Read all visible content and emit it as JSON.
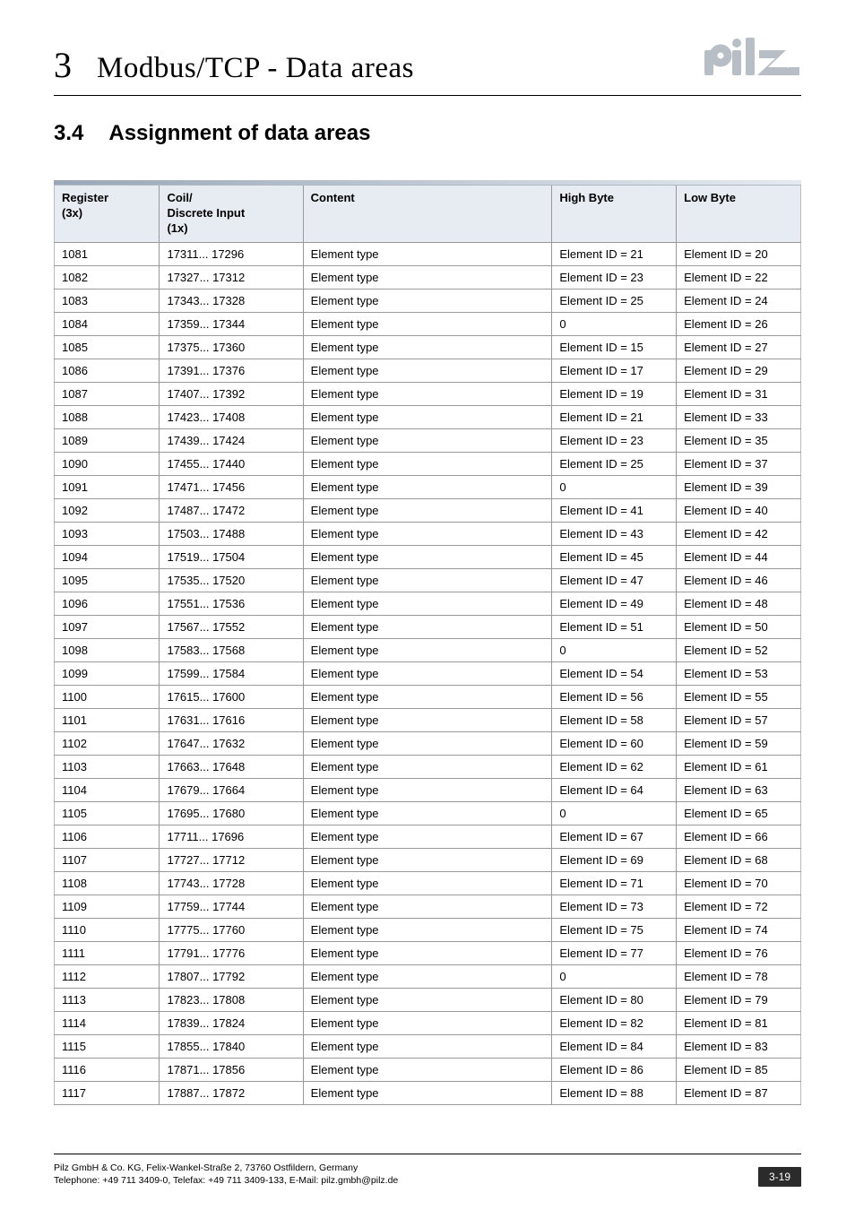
{
  "header": {
    "chapter_number": "3",
    "chapter_title": "Modbus/TCP - Data areas",
    "logo_text": "pilz"
  },
  "section": {
    "number": "3.4",
    "title": "Assignment of data areas"
  },
  "table": {
    "headers": {
      "register": "Register (3x)",
      "coil": "Coil/\nDiscrete Input (1x)",
      "content": "Content",
      "high": "High Byte",
      "low": "Low Byte"
    },
    "rows": [
      {
        "reg": "1081",
        "coil": "17311... 17296",
        "content": "Element type",
        "high": "Element ID = 21",
        "low": "Element ID = 20"
      },
      {
        "reg": "1082",
        "coil": "17327... 17312",
        "content": "Element type",
        "high": "Element ID = 23",
        "low": "Element ID = 22"
      },
      {
        "reg": "1083",
        "coil": "17343... 17328",
        "content": "Element type",
        "high": "Element ID = 25",
        "low": "Element ID = 24"
      },
      {
        "reg": "1084",
        "coil": "17359... 17344",
        "content": "Element type",
        "high": "0",
        "low": "Element ID = 26"
      },
      {
        "reg": "1085",
        "coil": "17375... 17360",
        "content": "Element type",
        "high": "Element ID = 15",
        "low": "Element ID = 27"
      },
      {
        "reg": "1086",
        "coil": "17391... 17376",
        "content": "Element type",
        "high": "Element ID = 17",
        "low": "Element ID = 29"
      },
      {
        "reg": "1087",
        "coil": "17407... 17392",
        "content": "Element type",
        "high": "Element ID = 19",
        "low": "Element ID = 31"
      },
      {
        "reg": "1088",
        "coil": "17423... 17408",
        "content": "Element type",
        "high": "Element ID = 21",
        "low": "Element ID = 33"
      },
      {
        "reg": "1089",
        "coil": "17439... 17424",
        "content": "Element type",
        "high": "Element ID = 23",
        "low": "Element ID = 35"
      },
      {
        "reg": "1090",
        "coil": "17455... 17440",
        "content": "Element type",
        "high": "Element ID = 25",
        "low": "Element ID = 37"
      },
      {
        "reg": "1091",
        "coil": "17471... 17456",
        "content": "Element type",
        "high": "0",
        "low": "Element ID = 39"
      },
      {
        "reg": "1092",
        "coil": "17487... 17472",
        "content": "Element type",
        "high": "Element ID = 41",
        "low": "Element ID = 40"
      },
      {
        "reg": "1093",
        "coil": "17503... 17488",
        "content": "Element type",
        "high": "Element ID = 43",
        "low": "Element ID = 42"
      },
      {
        "reg": "1094",
        "coil": "17519... 17504",
        "content": "Element type",
        "high": "Element ID = 45",
        "low": "Element ID = 44"
      },
      {
        "reg": "1095",
        "coil": "17535... 17520",
        "content": "Element type",
        "high": "Element ID = 47",
        "low": "Element ID = 46"
      },
      {
        "reg": "1096",
        "coil": "17551... 17536",
        "content": "Element type",
        "high": "Element ID = 49",
        "low": "Element ID = 48"
      },
      {
        "reg": "1097",
        "coil": "17567... 17552",
        "content": "Element type",
        "high": "Element ID = 51",
        "low": "Element ID = 50"
      },
      {
        "reg": "1098",
        "coil": "17583... 17568",
        "content": "Element type",
        "high": "0",
        "low": "Element ID = 52"
      },
      {
        "reg": "1099",
        "coil": "17599... 17584",
        "content": "Element type",
        "high": "Element ID = 54",
        "low": "Element ID = 53"
      },
      {
        "reg": "1100",
        "coil": "17615... 17600",
        "content": "Element type",
        "high": "Element ID = 56",
        "low": "Element ID = 55"
      },
      {
        "reg": "1101",
        "coil": "17631... 17616",
        "content": "Element type",
        "high": "Element ID = 58",
        "low": "Element ID = 57"
      },
      {
        "reg": "1102",
        "coil": "17647... 17632",
        "content": "Element type",
        "high": "Element ID = 60",
        "low": "Element ID = 59"
      },
      {
        "reg": "1103",
        "coil": "17663... 17648",
        "content": "Element type",
        "high": "Element ID = 62",
        "low": "Element ID = 61"
      },
      {
        "reg": "1104",
        "coil": "17679... 17664",
        "content": "Element type",
        "high": "Element ID = 64",
        "low": "Element ID = 63"
      },
      {
        "reg": "1105",
        "coil": "17695... 17680",
        "content": "Element type",
        "high": "0",
        "low": "Element ID = 65"
      },
      {
        "reg": "1106",
        "coil": "17711... 17696",
        "content": "Element type",
        "high": "Element ID = 67",
        "low": "Element ID = 66"
      },
      {
        "reg": "1107",
        "coil": "17727... 17712",
        "content": "Element type",
        "high": "Element ID = 69",
        "low": "Element ID = 68"
      },
      {
        "reg": "1108",
        "coil": "17743... 17728",
        "content": "Element type",
        "high": "Element ID = 71",
        "low": "Element ID = 70"
      },
      {
        "reg": "1109",
        "coil": "17759... 17744",
        "content": "Element type",
        "high": "Element ID = 73",
        "low": "Element ID = 72"
      },
      {
        "reg": "1110",
        "coil": "17775... 17760",
        "content": "Element type",
        "high": "Element ID = 75",
        "low": "Element ID = 74"
      },
      {
        "reg": "1111",
        "coil": "17791... 17776",
        "content": "Element type",
        "high": "Element ID = 77",
        "low": "Element ID = 76"
      },
      {
        "reg": "1112",
        "coil": "17807... 17792",
        "content": "Element type",
        "high": "0",
        "low": "Element ID = 78"
      },
      {
        "reg": "1113",
        "coil": "17823... 17808",
        "content": "Element type",
        "high": "Element ID = 80",
        "low": "Element ID = 79"
      },
      {
        "reg": "1114",
        "coil": "17839... 17824",
        "content": "Element type",
        "high": "Element ID = 82",
        "low": "Element ID = 81"
      },
      {
        "reg": "1115",
        "coil": "17855... 17840",
        "content": "Element type",
        "high": "Element ID = 84",
        "low": "Element ID = 83"
      },
      {
        "reg": "1116",
        "coil": "17871... 17856",
        "content": "Element type",
        "high": "Element ID = 86",
        "low": "Element ID = 85"
      },
      {
        "reg": "1117",
        "coil": "17887... 17872",
        "content": "Element type",
        "high": "Element ID = 88",
        "low": "Element ID = 87"
      }
    ]
  },
  "footer": {
    "line1": "Pilz GmbH & Co. KG, Felix-Wankel-Straße 2, 73760 Ostfildern, Germany",
    "line2": "Telephone: +49 711 3409-0, Telefax: +49 711 3409-133, E-Mail: pilz.gmbh@pilz.de",
    "page": "3-19"
  }
}
